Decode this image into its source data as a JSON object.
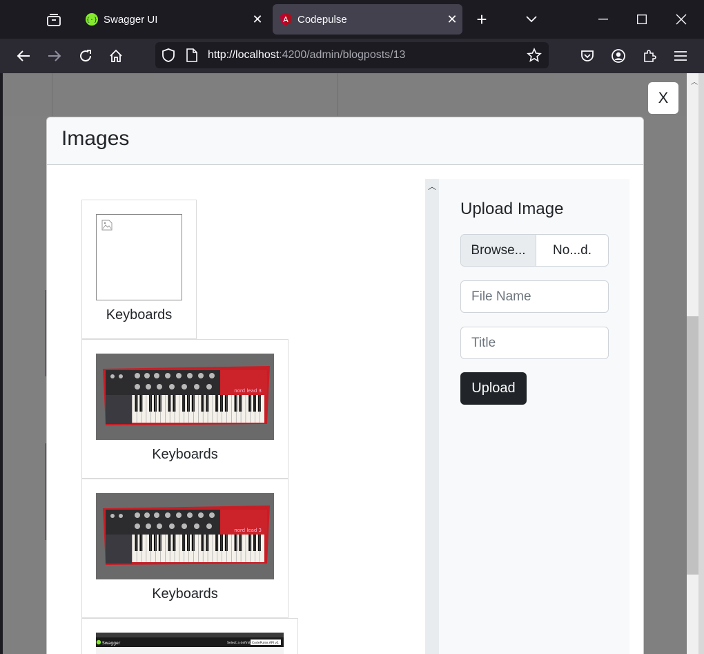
{
  "browser": {
    "tabs": [
      {
        "title": "Swagger UI",
        "icon": "swagger-favicon",
        "active": false
      },
      {
        "title": "Codepulse",
        "icon": "angular-favicon",
        "active": true
      }
    ],
    "url_host": "http://localhost",
    "url_rest": ":4200/admin/blogposts/13"
  },
  "modal": {
    "title": "Images",
    "close_label": "X"
  },
  "images": [
    {
      "title": "Keyboards",
      "kind": "broken-image"
    },
    {
      "title": "Keyboards",
      "kind": "keyboard-photo"
    },
    {
      "title": "Keyboards",
      "kind": "keyboard-photo"
    },
    {
      "title": "",
      "kind": "swagger-screenshot"
    }
  ],
  "swagger_thumb": {
    "brand": "Swagger",
    "select_label": "Select a definition",
    "select_value": "CodePulse.API v1"
  },
  "keyboard_thumb": {
    "brand_text": "nord lead 3"
  },
  "upload": {
    "title": "Upload Image",
    "browse_label": "Browse...",
    "file_status": "No...d.",
    "file_name_placeholder": "File Name",
    "title_placeholder": "Title",
    "button_label": "Upload"
  }
}
